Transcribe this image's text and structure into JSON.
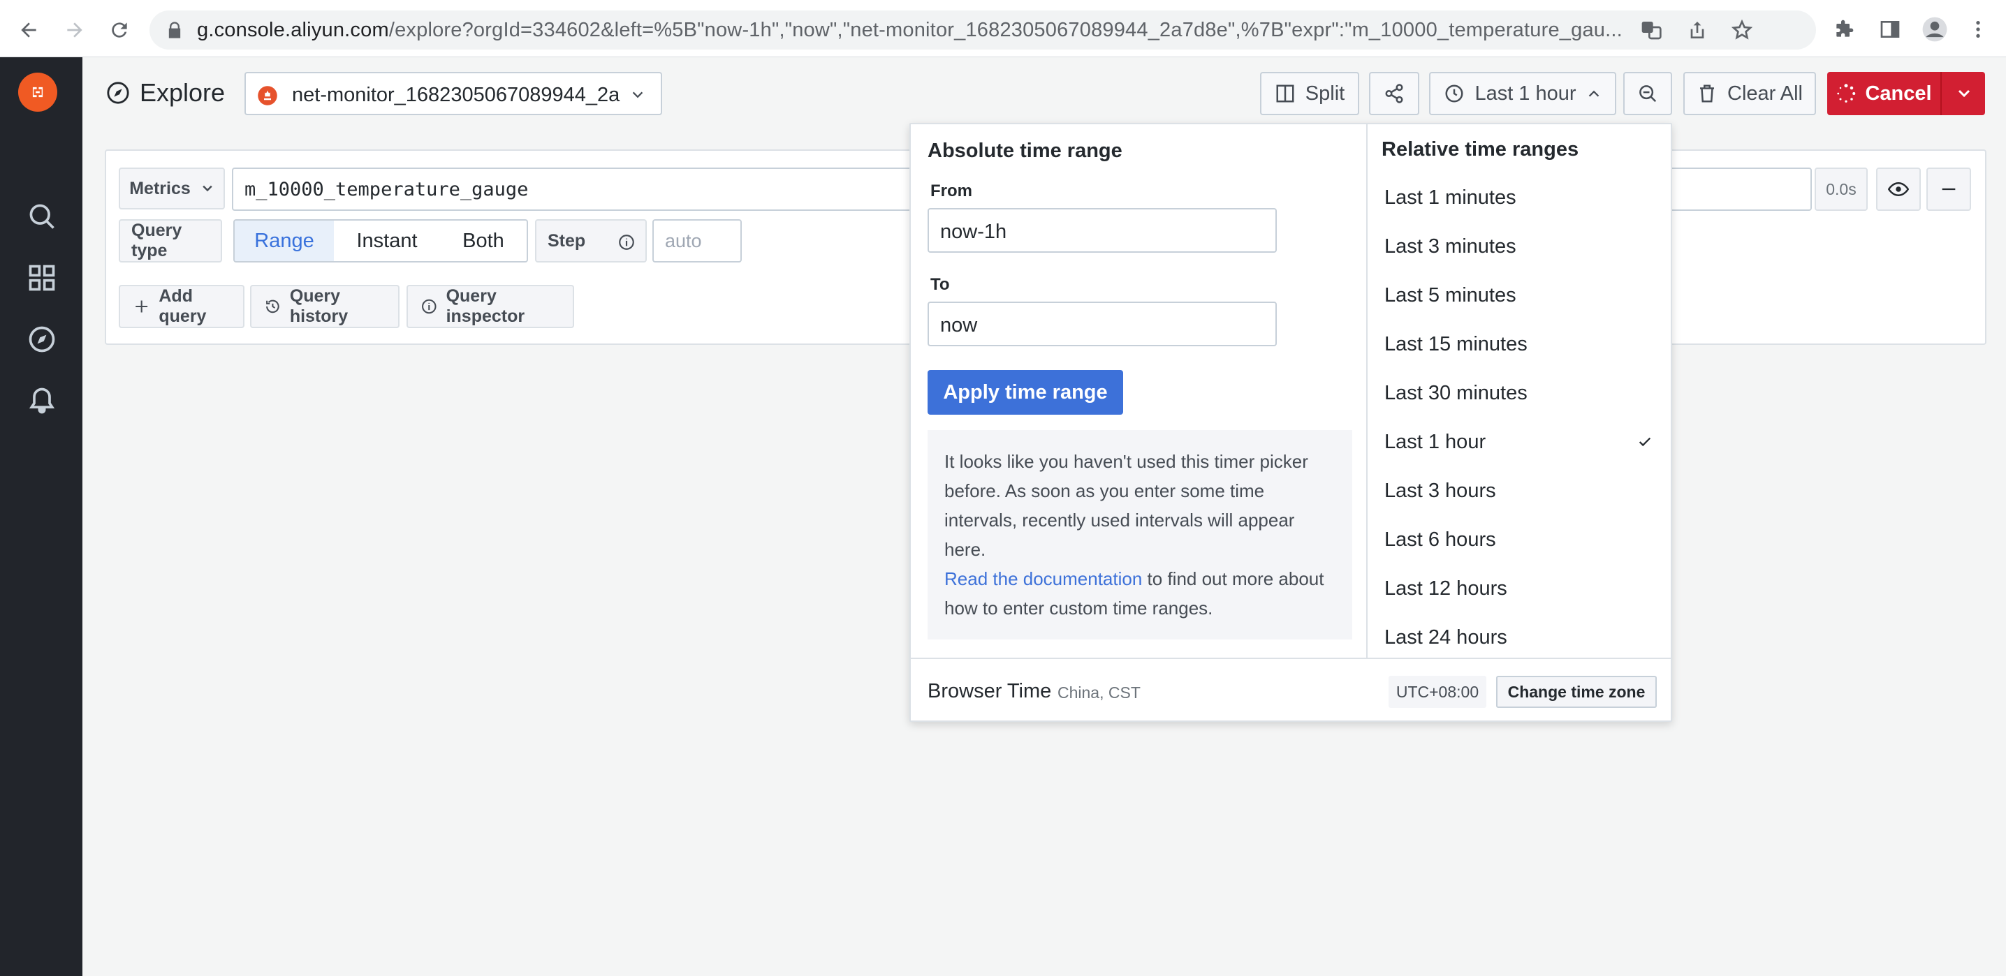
{
  "browser": {
    "url_host": "g.console.aliyun.com",
    "url_rest": "/explore?orgId=334602&left=%5B\"now-1h\",\"now\",\"net-monitor_1682305067089944_2a7d8e\",%7B\"expr\":\"m_10000_temperature_gau..."
  },
  "toolbar": {
    "title": "Explore",
    "datasource": "net-monitor_1682305067089944_2a7d8e",
    "split_label": "Split",
    "time_label": "Last 1 hour",
    "clear_label": "Clear All",
    "cancel_label": "Cancel"
  },
  "query": {
    "metrics_label": "Metrics",
    "expr": "m_10000_temperature_gauge",
    "duration": "0.0s",
    "query_type_label": "Query type",
    "types": [
      "Range",
      "Instant",
      "Both"
    ],
    "active_type": "Range",
    "step_label": "Step",
    "step_placeholder": "auto",
    "add_query": "Add query",
    "query_history": "Query history",
    "query_inspector": "Query inspector"
  },
  "time_picker": {
    "absolute_title": "Absolute time range",
    "from_label": "From",
    "from_value": "now-1h",
    "to_label": "To",
    "to_value": "now",
    "apply_label": "Apply time range",
    "info_text": "It looks like you haven't used this timer picker before. As soon as you enter some time intervals, recently used intervals will appear here.",
    "info_link": "Read the documentation",
    "info_after": " to find out more about how to enter custom time ranges.",
    "relative_title": "Relative time ranges",
    "relative": [
      "Last 1 minutes",
      "Last 3 minutes",
      "Last 5 minutes",
      "Last 15 minutes",
      "Last 30 minutes",
      "Last 1 hour",
      "Last 3 hours",
      "Last 6 hours",
      "Last 12 hours",
      "Last 24 hours"
    ],
    "selected_relative": "Last 1 hour",
    "timezone_label": "Browser Time",
    "timezone_sub": "China, CST",
    "utc_offset": "UTC+08:00",
    "change_tz_label": "Change time zone"
  },
  "colors": {
    "sidebar": "#22252b",
    "accent": "#3d71d9",
    "danger": "#d21f32",
    "logo": "#f05a23"
  }
}
